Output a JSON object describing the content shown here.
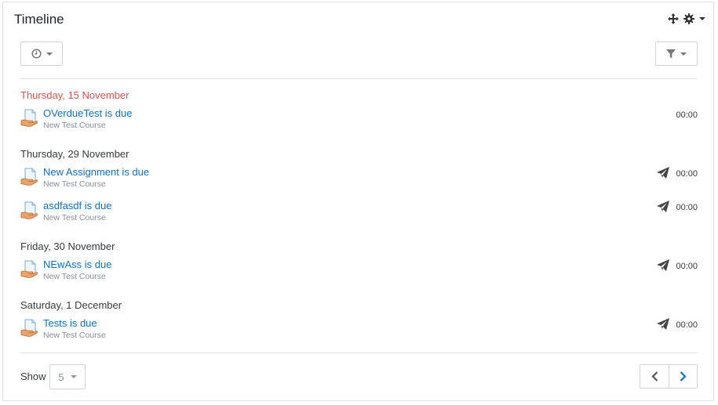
{
  "header": {
    "title": "Timeline",
    "icons": [
      "move-icon",
      "gear-icon",
      "chevron-down-icon"
    ]
  },
  "toolbar": {
    "sort_icon": "clock-icon",
    "filter_icon": "filter-icon"
  },
  "groups": [
    {
      "date": "Thursday, 15 November",
      "overdue": true,
      "events": [
        {
          "name": "OVerdueTest is due",
          "course": "New Test Course",
          "time": "00:00",
          "has_action": false
        }
      ]
    },
    {
      "date": "Thursday, 29 November",
      "overdue": false,
      "events": [
        {
          "name": "New Assignment is due",
          "course": "New Test Course",
          "time": "00:00",
          "has_action": true
        },
        {
          "name": "asdfasdf is due",
          "course": "New Test Course",
          "time": "00:00",
          "has_action": true
        }
      ]
    },
    {
      "date": "Friday, 30 November",
      "overdue": false,
      "events": [
        {
          "name": "NEwAss is due",
          "course": "New Test Course",
          "time": "00:00",
          "has_action": true
        }
      ]
    },
    {
      "date": "Saturday, 1 December",
      "overdue": false,
      "events": [
        {
          "name": "Tests is due",
          "course": "New Test Course",
          "time": "00:00",
          "has_action": true
        }
      ]
    }
  ],
  "footer": {
    "show_label": "Show",
    "show_value": "5"
  },
  "colors": {
    "link": "#0f6fc5",
    "overdue": "#d9534f",
    "border": "#dee2e6"
  }
}
